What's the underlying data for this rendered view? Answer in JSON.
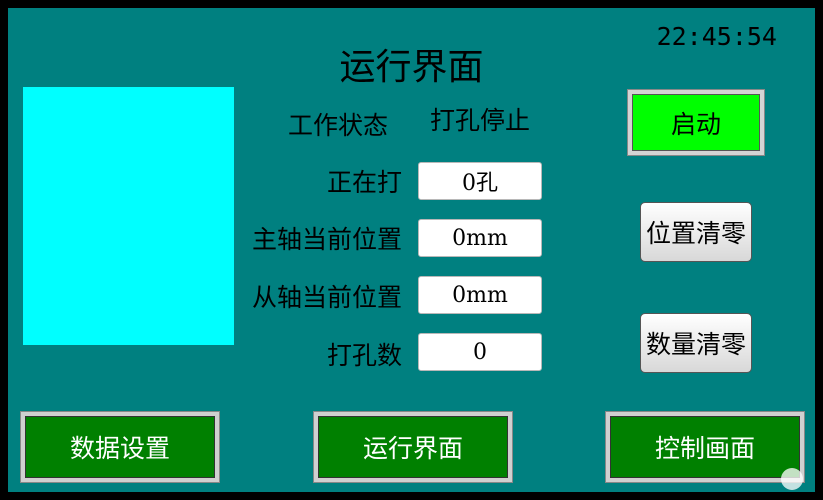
{
  "header": {
    "title": "运行界面",
    "clock": "22:45:54"
  },
  "status": {
    "label": "工作状态",
    "value": "打孔停止"
  },
  "fields": {
    "current_hole": {
      "label": "正在打",
      "value": "0孔"
    },
    "main_axis_position": {
      "label": "主轴当前位置",
      "value": "0mm"
    },
    "secondary_axis_position": {
      "label": "从轴当前位置",
      "value": "0mm"
    },
    "hole_count": {
      "label": "打孔数",
      "value": "0"
    }
  },
  "buttons": {
    "start": "启动",
    "reset_position": "位置清零",
    "reset_count": "数量清零"
  },
  "nav": {
    "data_settings": "数据设置",
    "run_screen": "运行界面",
    "control_screen": "控制画面"
  },
  "colors": {
    "background": "#008080",
    "display_panel": "#00ffff",
    "start_button": "#00ff00",
    "nav_button": "#008000"
  }
}
